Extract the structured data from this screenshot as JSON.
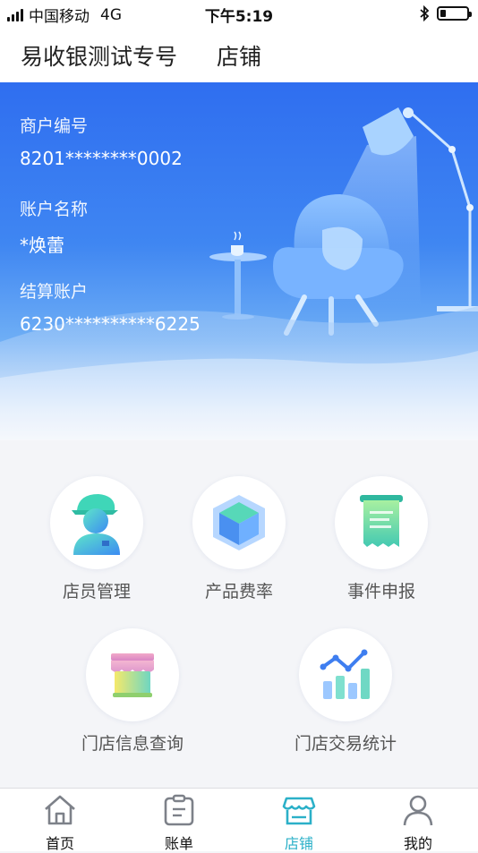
{
  "status_bar": {
    "carrier": "中国移动",
    "network": "4G",
    "time": "下午5:19",
    "battery_level": 0.2
  },
  "header": {
    "title": "易收银测试专号",
    "subtitle": "店铺"
  },
  "merchant": {
    "merchant_no_label": "商户编号",
    "merchant_no": "8201********0002",
    "account_name_label": "账户名称",
    "account_name": "*焕蕾",
    "settlement_label": "结算账户",
    "settlement_account": "6230**********6225"
  },
  "functions": [
    {
      "label": "店员管理",
      "icon": "staff-icon"
    },
    {
      "label": "产品费率",
      "icon": "cube-icon"
    },
    {
      "label": "事件申报",
      "icon": "receipt-icon"
    },
    {
      "label": "门店信息查询",
      "icon": "storefront-icon"
    },
    {
      "label": "门店交易统计",
      "icon": "chart-icon"
    }
  ],
  "tabbar": {
    "items": [
      {
        "label": "首页",
        "icon": "home-icon",
        "active": false
      },
      {
        "label": "账单",
        "icon": "bill-icon",
        "active": false
      },
      {
        "label": "店铺",
        "icon": "shop-icon",
        "active": true
      },
      {
        "label": "我的",
        "icon": "user-icon",
        "active": false
      }
    ],
    "active_color": "#2bb0c8"
  },
  "colors": {
    "hero_blue": "#2f6ef0",
    "accent_teal": "#2bb0c8"
  }
}
